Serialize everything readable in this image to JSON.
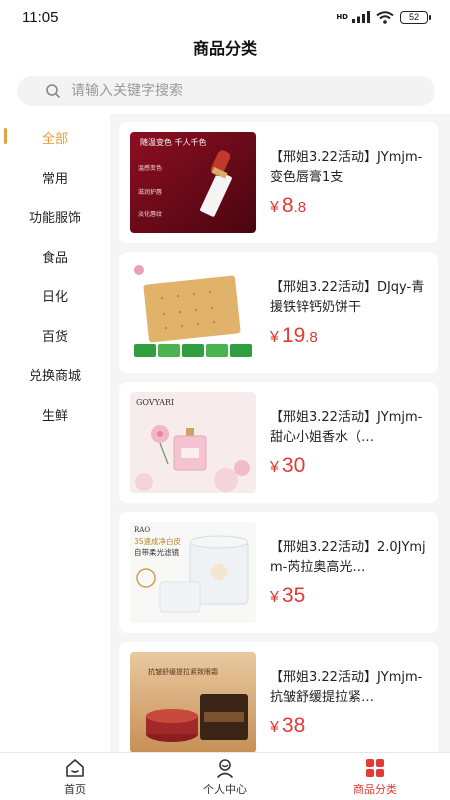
{
  "status": {
    "time": "11:05",
    "network": "HD",
    "battery": "52"
  },
  "page": {
    "title": "商品分类"
  },
  "search": {
    "placeholder": "请输入关键字搜索"
  },
  "categories": [
    {
      "label": "全部",
      "active": true
    },
    {
      "label": "常用",
      "active": false
    },
    {
      "label": "功能服饰",
      "active": false
    },
    {
      "label": "食品",
      "active": false
    },
    {
      "label": "日化",
      "active": false
    },
    {
      "label": "百货",
      "active": false
    },
    {
      "label": "兑换商城",
      "active": false
    },
    {
      "label": "生鲜",
      "active": false
    }
  ],
  "products": [
    {
      "name": "【邢姐3.22活动】JYmjm-变色唇膏1支",
      "currency": "¥",
      "price_int": "8",
      "price_dec": ".8",
      "image": {
        "lines": [
          "随温变色 千人千色",
          "温感变色",
          "滋润护唇",
          "淡化唇纹"
        ]
      }
    },
    {
      "name": "【邢姐3.22活动】DJqy-青援铁锌钙奶饼干",
      "currency": "¥",
      "price_int": "19",
      "price_dec": ".8",
      "image": {
        "lines": []
      }
    },
    {
      "name": "【邢姐3.22活动】JYmjm-甜心小姐香水（…",
      "currency": "¥",
      "price_int": "30",
      "price_dec": "",
      "image": {
        "lines": [
          "GOVYARI"
        ]
      }
    },
    {
      "name": "【邢姐3.22活动】2.0JYmjm-芮拉奥高光…",
      "currency": "¥",
      "price_int": "35",
      "price_dec": "",
      "image": {
        "lines": [
          "RAO",
          "3S速成净白皮",
          "自带柔光滤镜"
        ]
      }
    },
    {
      "name": "【邢姐3.22活动】JYmjm-抗皱舒缓提拉紧…",
      "currency": "¥",
      "price_int": "38",
      "price_dec": "",
      "image": {
        "lines": [
          "抗皱舒缓提拉紧致眼霜"
        ]
      }
    }
  ],
  "tabbar": [
    {
      "label": "首页",
      "icon": "home-icon",
      "active": false
    },
    {
      "label": "个人中心",
      "icon": "user-icon",
      "active": false
    },
    {
      "label": "商品分类",
      "icon": "category-icon",
      "active": true
    }
  ],
  "colors": {
    "accent": "#e6a03b",
    "price": "#e53935",
    "tab_active": "#e53935"
  }
}
